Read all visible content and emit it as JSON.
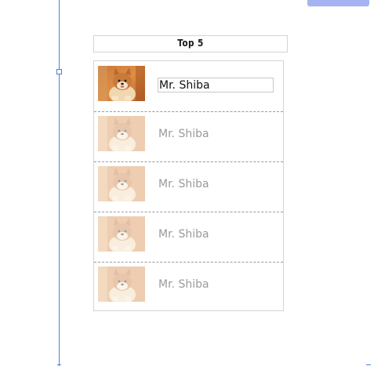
{
  "header": {
    "title": "Top 5"
  },
  "list": {
    "items": [
      {
        "name": "Mr. Shiba",
        "image": "shiba-dog-photo",
        "state": "editing"
      },
      {
        "name": "Mr. Shiba",
        "image": "shiba-dog-photo",
        "state": "faded"
      },
      {
        "name": "Mr. Shiba",
        "image": "shiba-dog-photo",
        "state": "faded"
      },
      {
        "name": "Mr. Shiba",
        "image": "shiba-dog-photo",
        "state": "faded"
      },
      {
        "name": "Mr. Shiba",
        "image": "shiba-dog-photo",
        "state": "faded"
      }
    ]
  },
  "colors": {
    "guide_line": "#4a7fe0",
    "top_button": "#a5b3f3",
    "border": "#d4d4d4",
    "faded_text": "#9a9a9a",
    "active_text": "#111111"
  }
}
